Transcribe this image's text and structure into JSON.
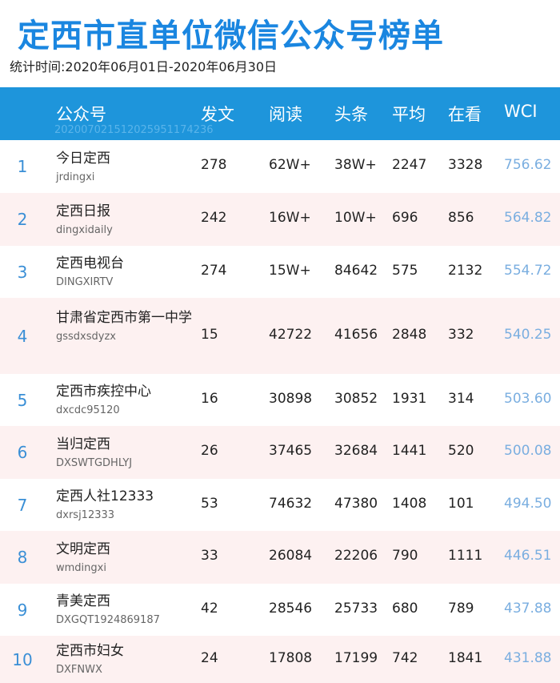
{
  "title": "定西市直单位微信公众号榜单",
  "subtitle": "统计时间:2020年06月01日-2020年06月30日",
  "header": {
    "name": "公众号",
    "posts": "发文",
    "reads": "阅读",
    "headline": "头条",
    "average": "平均",
    "watching": "在看",
    "wci": "WCI",
    "stamp": "20200702151202595117423​6"
  },
  "rows": [
    {
      "rank": "1",
      "name": "今日定西",
      "id": "jrdingxi",
      "posts": "278",
      "reads": "62W+",
      "headline": "38W+",
      "average": "2247",
      "watching": "3328",
      "wci": "756.62"
    },
    {
      "rank": "2",
      "name": "定西日报",
      "id": "dingxidaily",
      "posts": "242",
      "reads": "16W+",
      "headline": "10W+",
      "average": "696",
      "watching": "856",
      "wci": "564.82"
    },
    {
      "rank": "3",
      "name": "定西电视台",
      "id": "DINGXIRTV",
      "posts": "274",
      "reads": "15W+",
      "headline": "84642",
      "average": "575",
      "watching": "2132",
      "wci": "554.72"
    },
    {
      "rank": "4",
      "name": "甘肃省定西市第一中学",
      "id": "gssdxsdyzx",
      "posts": "15",
      "reads": "42722",
      "headline": "41656",
      "average": "2848",
      "watching": "332",
      "wci": "540.25"
    },
    {
      "rank": "5",
      "name": "定西市疾控中心",
      "id": "dxcdc95120",
      "posts": "16",
      "reads": "30898",
      "headline": "30852",
      "average": "1931",
      "watching": "314",
      "wci": "503.60"
    },
    {
      "rank": "6",
      "name": "当归定西",
      "id": "DXSWTGDHLYJ",
      "posts": "26",
      "reads": "37465",
      "headline": "32684",
      "average": "1441",
      "watching": "520",
      "wci": "500.08"
    },
    {
      "rank": "7",
      "name": "定西人社12333",
      "id": "dxrsj12333",
      "posts": "53",
      "reads": "74632",
      "headline": "47380",
      "average": "1408",
      "watching": "101",
      "wci": "494.50"
    },
    {
      "rank": "8",
      "name": "文明定西",
      "id": "wmdingxi",
      "posts": "33",
      "reads": "26084",
      "headline": "22206",
      "average": "790",
      "watching": "1111",
      "wci": "446.51"
    },
    {
      "rank": "9",
      "name": "青美定西",
      "id": "DXGQT1924869187",
      "posts": "42",
      "reads": "28546",
      "headline": "25733",
      "average": "680",
      "watching": "789",
      "wci": "437.88"
    },
    {
      "rank": "10",
      "name": "定西市妇女",
      "id": "DXFNWX",
      "posts": "24",
      "reads": "17808",
      "headline": "17199",
      "average": "742",
      "watching": "1841",
      "wci": "431.88"
    }
  ]
}
